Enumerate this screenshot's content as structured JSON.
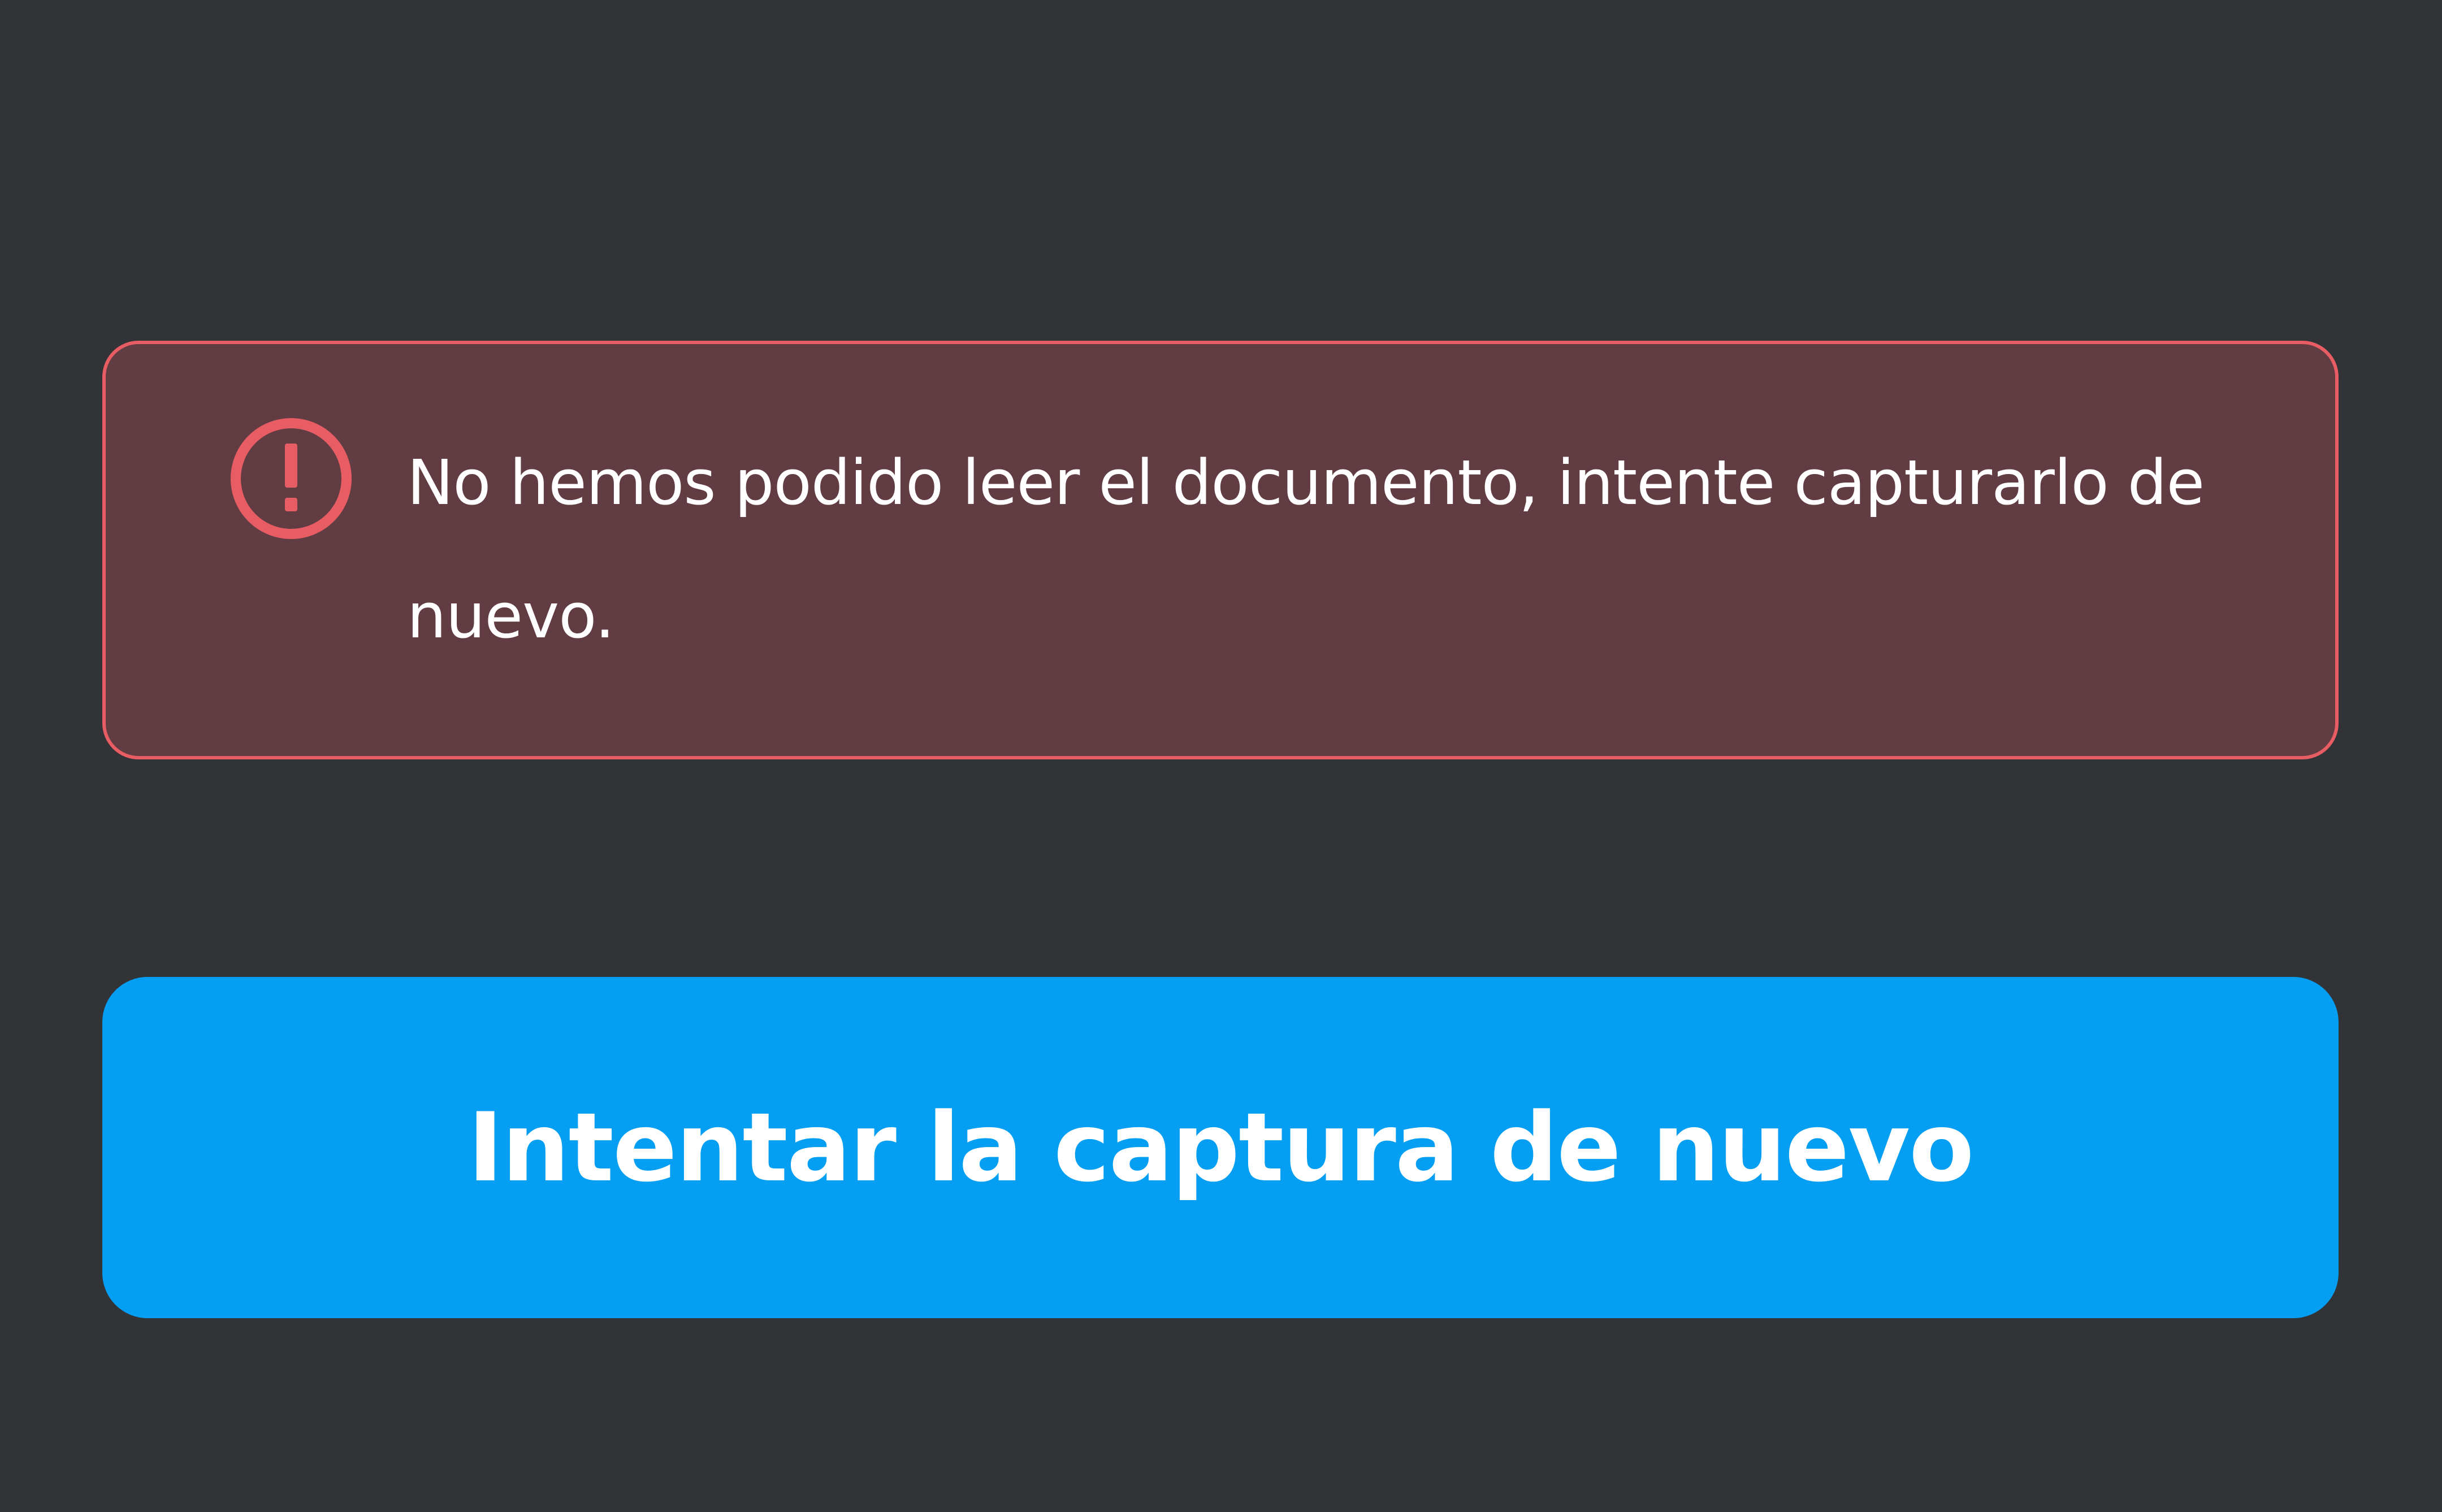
{
  "error_alert": {
    "icon": "exclamation-circle-icon",
    "message": "No hemos podido leer el documento, intente capturarlo de nuevo."
  },
  "retry_button": {
    "label": "Intentar la captura de nuevo"
  },
  "colors": {
    "background": "#323337",
    "alert_fill": "#623c43",
    "alert_accent": "#e85d63",
    "button": "#049ff3",
    "text": "#ffffff"
  }
}
